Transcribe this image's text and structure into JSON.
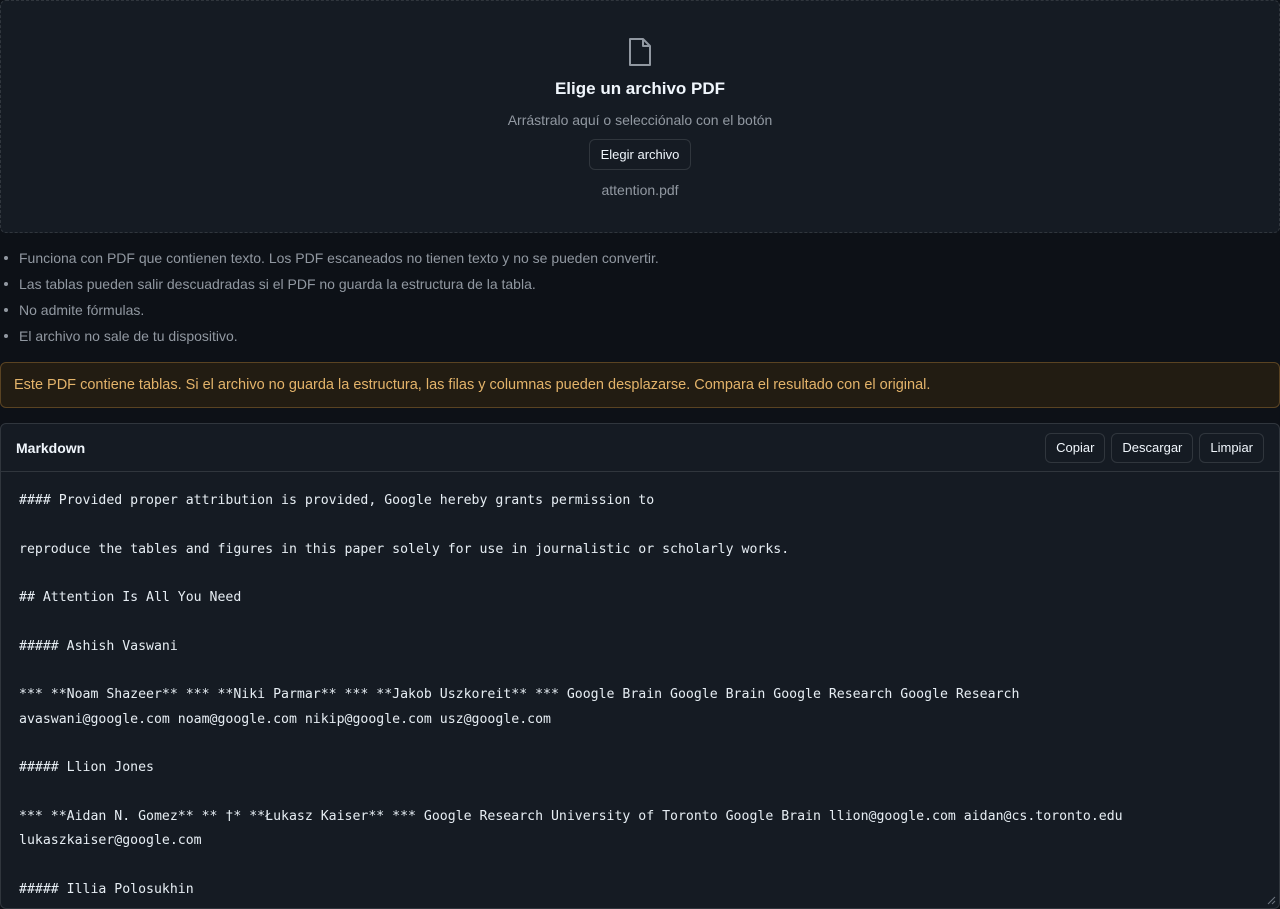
{
  "dropzone": {
    "icon": "file-icon",
    "title": "Elige un archivo PDF",
    "subtitle": "Arrástralo aquí o selecciónalo con el botón",
    "button_label": "Elegir archivo",
    "selected_file": "attention.pdf"
  },
  "notes": [
    "Funciona con PDF que contienen texto. Los PDF escaneados no tienen texto y no se pueden convertir.",
    "Las tablas pueden salir descuadradas si el PDF no guarda la estructura de la tabla.",
    "No admite fórmulas.",
    "El archivo no sale de tu dispositivo."
  ],
  "warning": "Este PDF contiene tablas. Si el archivo no guarda la estructura, las filas y columnas pueden desplazarse. Compara el resultado con el original.",
  "panel": {
    "title": "Markdown",
    "buttons": {
      "copy": "Copiar",
      "download": "Descargar",
      "clear": "Limpiar"
    },
    "content": "#### Provided proper attribution is provided, Google hereby grants permission to\n\nreproduce the tables and figures in this paper solely for use in journalistic or scholarly works.\n\n## Attention Is All You Need\n\n##### Ashish Vaswani\n\n*** **Noam Shazeer** *** **Niki Parmar** *** **Jakob Uszkoreit** *** Google Brain Google Brain Google Research Google Research\navaswani@google.com noam@google.com nikip@google.com usz@google.com\n\n##### Llion Jones\n\n*** **Aidan N. Gomez** ** †* **Łukasz Kaiser** *** Google Research University of Toronto Google Brain llion@google.com aidan@cs.toronto.edu\nlukaszkaiser@google.com\n\n##### Illia Polosukhin"
  },
  "colors": {
    "background": "#0d1117",
    "surface": "#151b23",
    "border": "#30363d",
    "muted_text": "#9198a1",
    "warning_text": "#e3b36a",
    "warning_bg": "#221c12"
  }
}
